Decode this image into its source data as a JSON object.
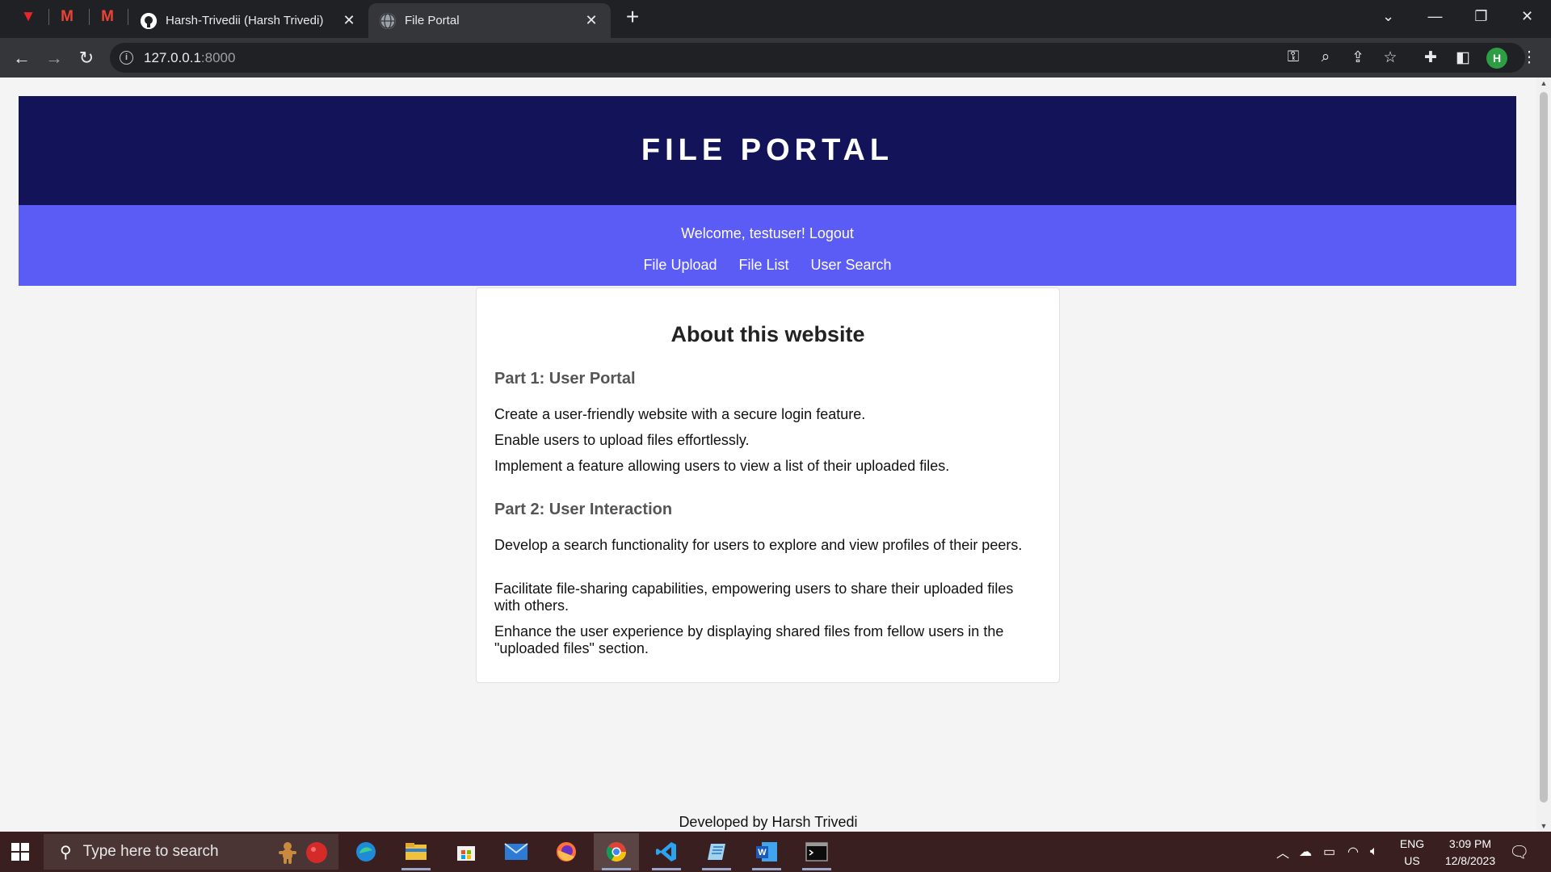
{
  "browser": {
    "tabs": [
      {
        "title": "Harsh-Trivedii (Harsh Trivedi)",
        "favicon": "github-icon",
        "active": false
      },
      {
        "title": "File Portal",
        "favicon": "globe-icon",
        "active": true
      }
    ],
    "pinned_tabs": [
      "vivaldi-icon",
      "gmail-icon",
      "gmail-icon"
    ],
    "address": {
      "host": "127.0.0.1",
      "port": ":8000"
    },
    "profile_initial": "H"
  },
  "site": {
    "title": "FILE PORTAL",
    "welcome_text": "Welcome, testuser!",
    "logout_label": "Logout",
    "nav": [
      "File Upload",
      "File List",
      "User Search"
    ],
    "about": {
      "heading": "About this website",
      "part1_title": "Part 1: User Portal",
      "part1_items": [
        "Create a user-friendly website with a secure login feature.",
        "Enable users to upload files effortlessly.",
        "Implement a feature allowing users to view a list of their uploaded files."
      ],
      "part2_title": "Part 2: User Interaction",
      "part2_items": [
        "Develop a search functionality for users to explore and view profiles of their peers.",
        "Facilitate file-sharing capabilities, empowering users to share their uploaded files with others.",
        "Enhance the user experience by displaying shared files from fellow users in the \"uploaded files\" section."
      ]
    },
    "footer": "Developed by Harsh Trivedi"
  },
  "taskbar": {
    "search_placeholder": "Type here to search",
    "apps": [
      "edge-icon",
      "file-explorer-icon",
      "store-icon",
      "mail-icon",
      "firefox-icon",
      "chrome-icon",
      "vscode-icon",
      "notes-icon",
      "word-icon",
      "terminal-icon"
    ],
    "language": [
      "ENG",
      "US"
    ],
    "time": "3:09 PM",
    "date": "12/8/2023"
  },
  "colors": {
    "header_bg": "#13135a",
    "nav_bg": "#5b5cf5",
    "page_bg": "#f4f4f4"
  }
}
